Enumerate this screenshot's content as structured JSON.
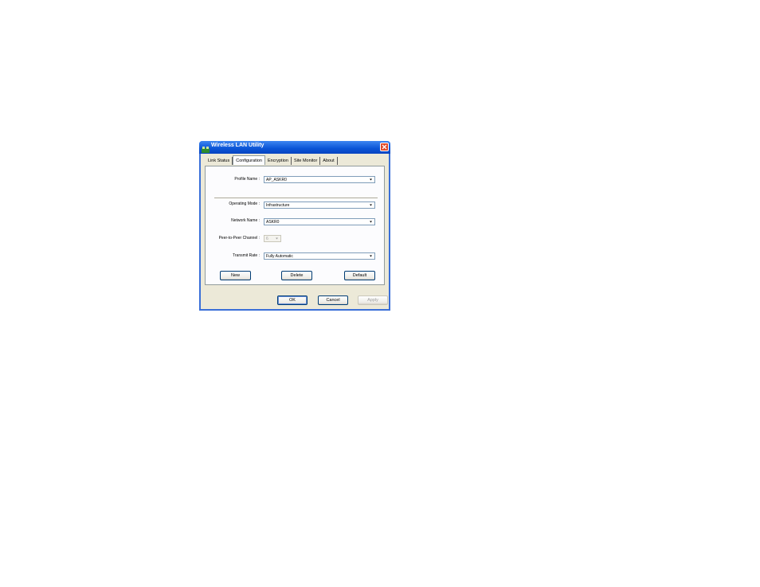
{
  "window": {
    "title": "Wireless LAN Utility",
    "accent_color": "#0a54d6"
  },
  "tabs": [
    {
      "label": "Link Status",
      "active": false
    },
    {
      "label": "Configuration",
      "active": true
    },
    {
      "label": "Encryption",
      "active": false
    },
    {
      "label": "Site Monitor",
      "active": false
    },
    {
      "label": "About",
      "active": false
    }
  ],
  "form": {
    "profile_name": {
      "label": "Profile Name :",
      "value": "AP_ASKR0"
    },
    "operating_mode": {
      "label": "Operating Mode :",
      "value": "Infrastructure"
    },
    "network_name": {
      "label": "Network Name :",
      "value": "ASKR0"
    },
    "peer_channel": {
      "label": "Peer-to-Peer Channel :",
      "value": "6"
    },
    "transmit_rate": {
      "label": "Transmit Rate :",
      "value": "Fully Automatic"
    }
  },
  "panel_buttons": {
    "new": "New",
    "delete": "Delete",
    "default": "Default"
  },
  "dialog_buttons": {
    "ok": "OK",
    "cancel": "Cancel",
    "apply": "Apply"
  },
  "icons": {
    "title": "network-card-icon",
    "close": "close-icon",
    "dropdown": "chevron-down-icon"
  }
}
